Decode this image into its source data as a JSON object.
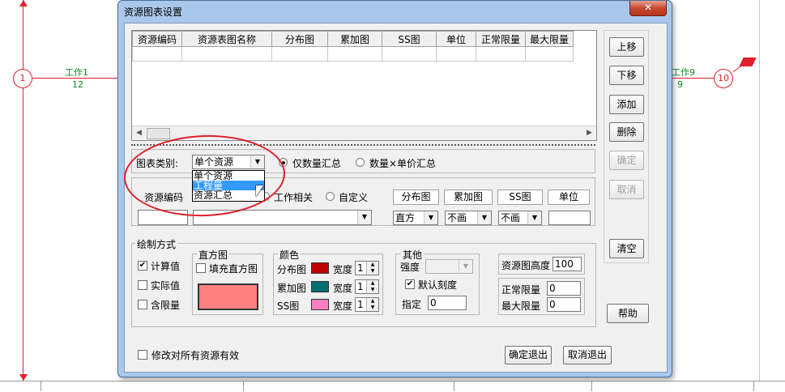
{
  "background": {
    "nodes": [
      {
        "label": "1"
      },
      {
        "label": "10"
      }
    ],
    "edges": [
      {
        "name": "工作1",
        "value": "12"
      },
      {
        "name": "工作9",
        "value": "9"
      }
    ],
    "accent_red": "#e0202a",
    "accent_green": "#0a8a2a"
  },
  "dialog": {
    "title": "资源图表设置",
    "close_glyph": "✕",
    "table": {
      "columns": [
        "资源编码",
        "资源表图名称",
        "分布图",
        "累加图",
        "SS图",
        "单位",
        "正常限量",
        "最大限量"
      ]
    },
    "right_buttons": {
      "up": "上移",
      "down": "下移",
      "add": "添加",
      "delete": "删除",
      "confirm": "确定",
      "cancel": "取消",
      "clear": "清空",
      "help": "帮助"
    },
    "chart_type": {
      "label": "图表类别:",
      "selected": "单个资源",
      "options": [
        "单个资源",
        "工程量",
        "资源汇总"
      ],
      "highlighted": "工程量",
      "radio_qty_only": "仅数量汇总",
      "radio_qty_price": "数量×单价汇总"
    },
    "resource_row": {
      "code_label": "资源编码",
      "radio_work_related": "工作相关",
      "radio_custom": "自定义",
      "headers": [
        "分布图",
        "累加图",
        "SS图",
        "单位"
      ],
      "dist_value": "直方",
      "accum_value": "不画",
      "ss_value": "不画"
    },
    "draw": {
      "title": "绘制方式",
      "calc": "计算值",
      "actual": "实际值",
      "limit": "含限量",
      "histogram_title": "直方图",
      "fill_histogram": "填充直方图",
      "histogram_color": "#ff8080",
      "color_title": "颜色",
      "dist_chart": "分布图",
      "accum_chart": "累加图",
      "ss_chart": "SS图",
      "width_label": "宽度",
      "dist_width": "1",
      "accum_width": "1",
      "ss_width": "1",
      "dist_color": "#c00000",
      "accum_color": "#007070",
      "ss_color": "#ff80c0",
      "other_title": "其他",
      "strength_label": "强度",
      "default_scale": "默认刻度",
      "specify_label": "指定",
      "specify_value": "0",
      "height_label": "资源图高度",
      "height_value": "100",
      "normal_limit_label": "正常限量",
      "normal_limit_value": "0",
      "max_limit_label": "最大限量",
      "max_limit_value": "0"
    },
    "bottom": {
      "apply_all": "修改对所有资源有效",
      "ok_exit": "确定退出",
      "cancel_exit": "取消退出"
    }
  }
}
